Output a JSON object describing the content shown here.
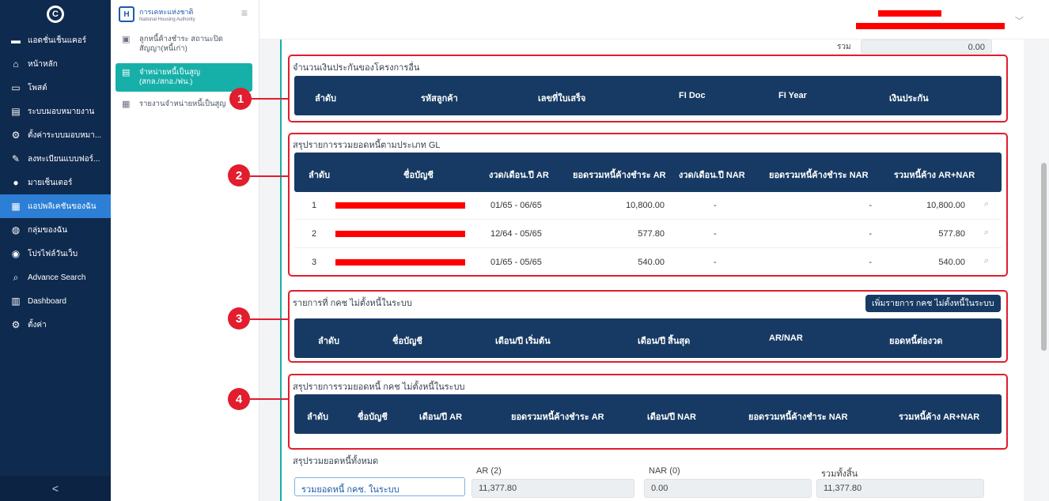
{
  "sidebar": {
    "logo": "C",
    "items": [
      {
        "icon": "store-icon",
        "glyph": "▬",
        "label": "แอดชั่นเช็นแคอร์"
      },
      {
        "icon": "home-icon",
        "glyph": "⌂",
        "label": "หน้าหลัก"
      },
      {
        "icon": "post-icon",
        "glyph": "▭",
        "label": "โพสต์"
      },
      {
        "icon": "doc-icon",
        "glyph": "▤",
        "label": "ระบบมอบหมายงาน"
      },
      {
        "icon": "gear-icon",
        "glyph": "⚙",
        "label": "ตั้งค่าระบบมอบหมา..."
      },
      {
        "icon": "form-icon",
        "glyph": "✎",
        "label": "ลงทะเบียนแบบฟอร์..."
      },
      {
        "icon": "user-icon",
        "glyph": "●",
        "label": "มายเซ็นเตอร์"
      },
      {
        "icon": "apps-icon",
        "glyph": "▦",
        "label": "แอปพลิเคชันของฉัน"
      },
      {
        "icon": "group-icon",
        "glyph": "◍",
        "label": "กลุ่มของฉัน"
      },
      {
        "icon": "profile-icon",
        "glyph": "◉",
        "label": "โปรไฟล์วันเว็บ"
      },
      {
        "icon": "search-icon",
        "glyph": "⌕",
        "label": "Advance Search"
      },
      {
        "icon": "chart-icon",
        "glyph": "▥",
        "label": "Dashboard"
      },
      {
        "icon": "settings-icon",
        "glyph": "⚙",
        "label": "ตั้งค่า"
      }
    ],
    "collapse": "<"
  },
  "subbar": {
    "org_th": "การเคหะแห่งชาติ",
    "org_en": "National Housing Authority",
    "items": [
      {
        "label": "ลูกหนี้ค้างชำระ สถานะปิดสัญญา(หนี้เก่า)"
      },
      {
        "label": "จำหน่ายหนี้เป็นสูญ (สกล./สกอ./ฟน.)"
      },
      {
        "label": "รายงานจำหน่ายหนี้เป็นสูญ"
      }
    ]
  },
  "top": {
    "total_label": "รวม",
    "total_value": "0.00"
  },
  "sec1": {
    "title": "จำนวนเงินประกันของโครงการอื่น",
    "cols": [
      "ลำดับ",
      "รหัสลูกค้า",
      "เลขที่ใบเสร็จ",
      "FI Doc",
      "FI Year",
      "เงินประกัน"
    ]
  },
  "sec2": {
    "title": "สรุปรายการรวมยอดหนี้ตามประเภท GL",
    "cols": [
      "ลำดับ",
      "ชื่อบัญชี",
      "งวด/เดือน.ปี AR",
      "ยอดรวมหนี้ค้างชำระ AR",
      "งวด/เดือน.ปี NAR",
      "ยอดรวมหนี้ค้างชำระ NAR",
      "รวมหนี้ค้าง AR+NAR"
    ],
    "rows": [
      {
        "no": "1",
        "period_ar": "01/65 - 06/65",
        "ar": "10,800.00",
        "period_nar": "-",
        "nar": "-",
        "total": "10,800.00"
      },
      {
        "no": "2",
        "period_ar": "12/64 - 05/65",
        "ar": "577.80",
        "period_nar": "-",
        "nar": "-",
        "total": "577.80"
      },
      {
        "no": "3",
        "period_ar": "01/65 - 05/65",
        "ar": "540.00",
        "period_nar": "-",
        "nar": "-",
        "total": "540.00"
      }
    ]
  },
  "sec3": {
    "title": "รายการที่ กคช ไม่ตั้งหนี้ในระบบ",
    "button": "เพิ่มรายการ กคช ไม่ตั้งหนี้ในระบบ",
    "cols": [
      "ลำดับ",
      "ชื่อบัญชี",
      "เดือน/ปี เริ่มต้น",
      "เดือน/ปี สิ้นสุด",
      "AR/NAR",
      "ยอดหนี้ต่องวด"
    ]
  },
  "sec4": {
    "title": "สรุปรายการรวมยอดหนี้ กคช ไม่ตั้งหนี้ในระบบ",
    "cols": [
      "ลำดับ",
      "ชื่อบัญชี",
      "เดือน/ปี AR",
      "ยอดรวมหนี้ค้างชำระ AR",
      "เดือน/ปี NAR",
      "ยอดรวมหนี้ค้างชำระ NAR",
      "รวมหนี้ค้าง AR+NAR"
    ]
  },
  "summary": {
    "title": "สรุปรวมยอดหนี้ทั้งหมด",
    "ar_label": "AR (2)",
    "nar_label": "NAR (0)",
    "total_label": "รวมทั้งสิ้น",
    "row_label": "รวมยอดหนี้ กคช. ในระบบ",
    "ar_value": "11,377.80",
    "nar_value": "0.00",
    "total_value": "11,377.80"
  },
  "markers": [
    "1",
    "2",
    "3",
    "4"
  ],
  "colors": {
    "sidebar": "#0f2a4f",
    "header": "#163a63",
    "accent": "#17b0a9",
    "highlight": "#e11d2e"
  }
}
